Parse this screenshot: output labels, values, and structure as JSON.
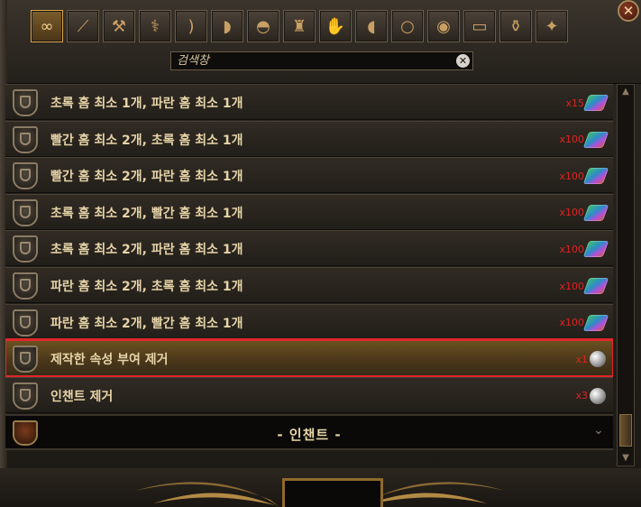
{
  "window": {
    "close_icon": "close-x-icon"
  },
  "tabs": [
    {
      "icon": "infinity-icon",
      "glyph": "∞",
      "active": true
    },
    {
      "icon": "wand-icon",
      "glyph": "⟋",
      "active": false
    },
    {
      "icon": "axe-icon",
      "glyph": "⚒",
      "active": false
    },
    {
      "icon": "claw-icon",
      "glyph": "⚕",
      "active": false
    },
    {
      "icon": "bow-icon",
      "glyph": ")",
      "active": false
    },
    {
      "icon": "shield-icon",
      "glyph": "◗",
      "active": false
    },
    {
      "icon": "helmet-icon",
      "glyph": "◓",
      "active": false
    },
    {
      "icon": "body-armour-icon",
      "glyph": "♜",
      "active": false
    },
    {
      "icon": "gloves-icon",
      "glyph": "✋",
      "active": false
    },
    {
      "icon": "boots-icon",
      "glyph": "◖",
      "active": false
    },
    {
      "icon": "ring-icon",
      "glyph": "○",
      "active": false
    },
    {
      "icon": "amulet-icon",
      "glyph": "◉",
      "active": false
    },
    {
      "icon": "belt-icon",
      "glyph": "▭",
      "active": false
    },
    {
      "icon": "flask-icon",
      "glyph": "⚱",
      "active": false
    },
    {
      "icon": "jewel-icon",
      "glyph": "✦",
      "active": false
    }
  ],
  "search": {
    "placeholder": "검색창",
    "value": "",
    "clear_glyph": "✕"
  },
  "recipes": [
    {
      "label": "초록 홈 최소 1개, 파란 홈 최소 1개",
      "qty": "x15",
      "cost_icon": "chromatic-orb-icon",
      "selected": false
    },
    {
      "label": "빨간 홈 최소 2개, 초록 홈 최소 1개",
      "qty": "x100",
      "cost_icon": "chromatic-orb-icon",
      "selected": false
    },
    {
      "label": "빨간 홈 최소 2개, 파란 홈 최소 1개",
      "qty": "x100",
      "cost_icon": "chromatic-orb-icon",
      "selected": false
    },
    {
      "label": "초록 홈 최소 2개, 빨간 홈 최소 1개",
      "qty": "x100",
      "cost_icon": "chromatic-orb-icon",
      "selected": false
    },
    {
      "label": "초록 홈 최소 2개, 파란 홈 최소 1개",
      "qty": "x100",
      "cost_icon": "chromatic-orb-icon",
      "selected": false
    },
    {
      "label": "파란 홈 최소 2개, 초록 홈 최소 1개",
      "qty": "x100",
      "cost_icon": "chromatic-orb-icon",
      "selected": false
    },
    {
      "label": "파란 홈 최소 2개, 빨간 홈 최소 1개",
      "qty": "x100",
      "cost_icon": "chromatic-orb-icon",
      "selected": false
    },
    {
      "label": "제작한 속성 부여 제거",
      "qty": "x1",
      "cost_icon": "scouring-orb-icon",
      "selected": true
    },
    {
      "label": "인챈트 제거",
      "qty": "x3",
      "cost_icon": "scouring-orb-icon",
      "selected": false
    }
  ],
  "section": {
    "label": "- 인챈트 -",
    "icon": "enchant-icon"
  },
  "colors": {
    "accent": "#d8a74d",
    "selection_outline": "#e0262b",
    "cost_text": "#e32222",
    "row_text": "#e6d4a8"
  }
}
